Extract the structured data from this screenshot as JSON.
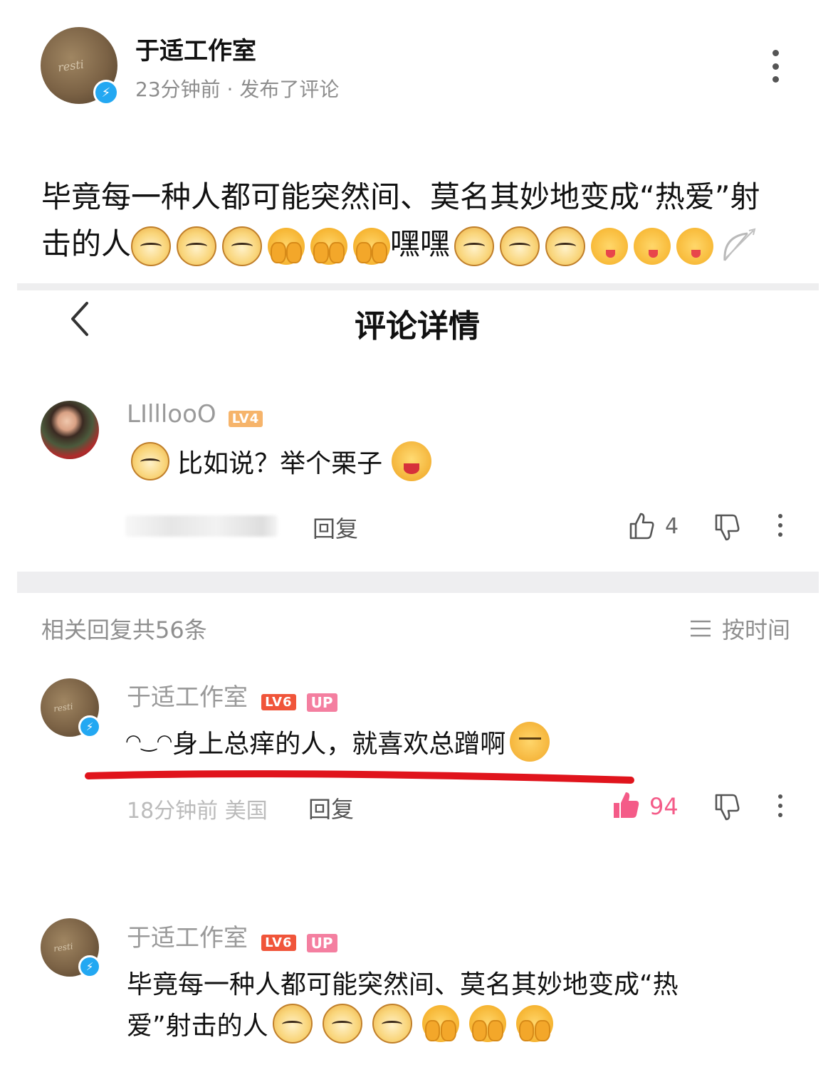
{
  "post": {
    "author": "于适工作室",
    "meta": "23分钟前 · 发布了评论",
    "text_line1": "毕竟每一种人都可能突然间、莫名其妙地变成“热爱”射",
    "text_line2_prefix": "击的人",
    "text_line2_mid": "嘿嘿"
  },
  "nav": {
    "title": "评论详情"
  },
  "main_comment": {
    "username": "LIlllooO",
    "level": "LV4",
    "text": "比如说？举个栗子",
    "reply_label": "回复",
    "like_count": "4"
  },
  "replies_header": {
    "summary": "相关回复共56条",
    "sort_label": "按时间"
  },
  "reply1": {
    "username": "于适工作室",
    "level": "LV6",
    "up_badge": "UP",
    "kaomoji": "◠‿◠",
    "text": "身上总痒的人，就喜欢总蹭啊",
    "timestamp": "18分钟前 美国",
    "reply_label": "回复",
    "like_count": "94"
  },
  "reply2": {
    "username": "于适工作室",
    "level": "LV6",
    "up_badge": "UP",
    "text_line1": "毕竟每一种人都可能突然间、莫名其妙地变成“热",
    "text_line2": "爱”射击的人"
  },
  "colors": {
    "verified_blue": "#23a8f2",
    "like_pink": "#f45b88",
    "underline_red": "#e0141c",
    "lv6": "#f0553a",
    "lv4": "#f6b46b",
    "up_badge": "#f47fa0"
  }
}
